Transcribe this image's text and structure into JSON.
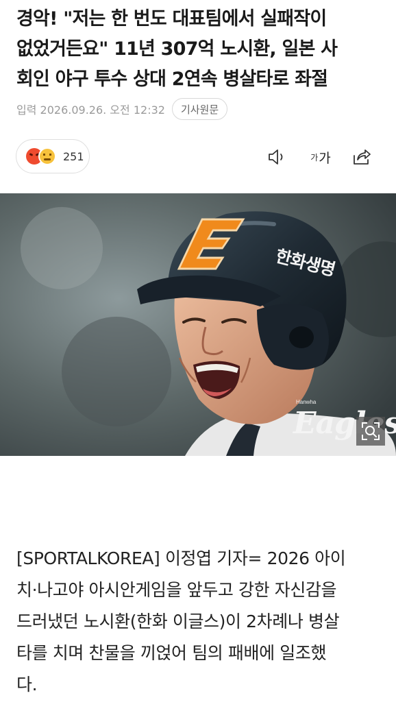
{
  "article": {
    "headline": "경악! \"저는 한 번도 대표팀에서 실패작이\n없었거든요\" 11년 307억 노시환, 일본 사\n회인 야구 투수 상대 2연속 병살타로 좌절",
    "published": "입력 2026.09.26. 오전 12:32",
    "original_button": "기사원문",
    "reactions": {
      "count": "251",
      "emojis": [
        "angry-emoji",
        "sad-emoji"
      ]
    },
    "toolbar": {
      "speaker_icon": "speaker-icon",
      "font_small": "가",
      "font_big": "가",
      "share_icon": "share-icon"
    },
    "photo": {
      "helmet_team_text": "한화생명",
      "watermark_small": "Hanwha",
      "watermark_large": "Eagles",
      "zoom_icon": "zoom-icon"
    },
    "body": "[SPORTALKOREA] 이정엽 기자= 2026 아이\n치·나고야 아시안게임을 앞두고 강한 자신감을\n드러냈던 노시환(한화 이글스)이 2차례나 병살\n타를 치며 찬물을 끼얹어 팀의 패배에 일조했\n다."
  },
  "colors": {
    "helmet": "#1f2a33",
    "logo_orange": "#f08a1c",
    "text_gray": "#9a9a9a"
  }
}
